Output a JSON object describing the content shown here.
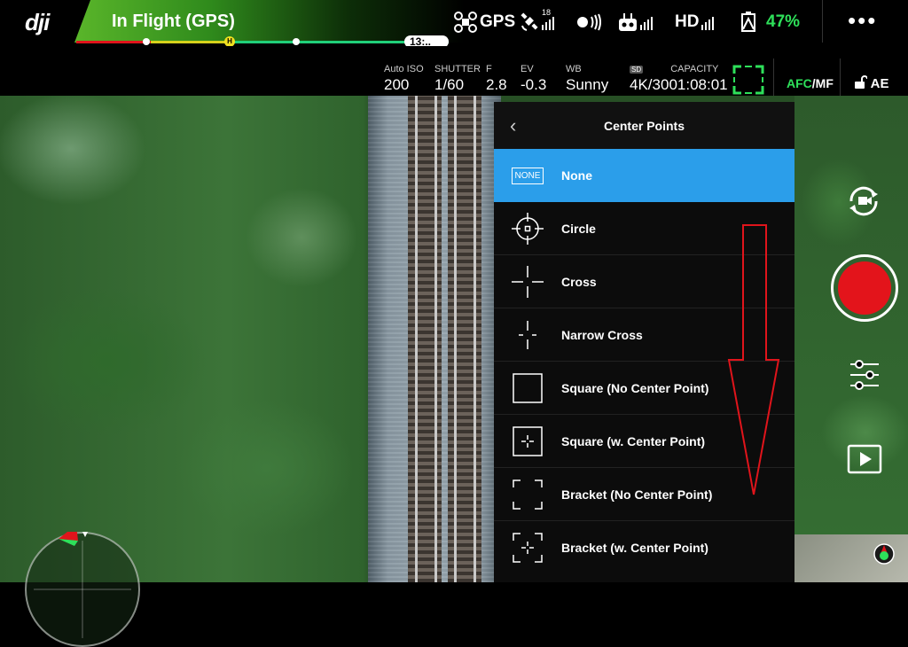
{
  "app": {
    "logo": "dji",
    "flight_status": "In Flight (GPS)",
    "flight_time": "13:..",
    "home_marker": "H"
  },
  "telemetry": {
    "gps_label": "GPS",
    "satellite_count": "18",
    "hd_label": "HD",
    "battery_percent": "47%",
    "more": "•••"
  },
  "camera": {
    "iso": {
      "label": "Auto ISO",
      "value": "200"
    },
    "shutter": {
      "label": "SHUTTER",
      "value": "1/60"
    },
    "aperture": {
      "label": "F",
      "value": "2.8"
    },
    "ev": {
      "label": "EV",
      "value": "-0.3"
    },
    "wb": {
      "label": "WB",
      "value": "Sunny"
    },
    "storage": {
      "badge": "SD",
      "label": "CAPACITY",
      "format": "4K/30",
      "capacity": "01:08:01"
    },
    "focus_mode_afc": "AFC",
    "focus_mode_mf": "/MF",
    "ae_lock": "AE"
  },
  "center_points_panel": {
    "title": "Center Points",
    "selected_index": 0,
    "none_badge": "NONE",
    "options": [
      {
        "label": "None",
        "icon": "none-badge-icon"
      },
      {
        "label": "Circle",
        "icon": "circle-crosshair-icon"
      },
      {
        "label": "Cross",
        "icon": "cross-icon"
      },
      {
        "label": "Narrow Cross",
        "icon": "narrow-cross-icon"
      },
      {
        "label": "Square (No Center Point)",
        "icon": "square-icon"
      },
      {
        "label": "Square (w. Center Point)",
        "icon": "square-center-icon"
      },
      {
        "label": "Bracket (No Center Point)",
        "icon": "bracket-icon"
      },
      {
        "label": "Bracket (w. Center Point)",
        "icon": "bracket-center-icon"
      }
    ]
  },
  "colors": {
    "selection": "#2b9eea",
    "record": "#e3141b",
    "battery": "#2ee05a",
    "annotation_arrow": "#e0141b"
  }
}
